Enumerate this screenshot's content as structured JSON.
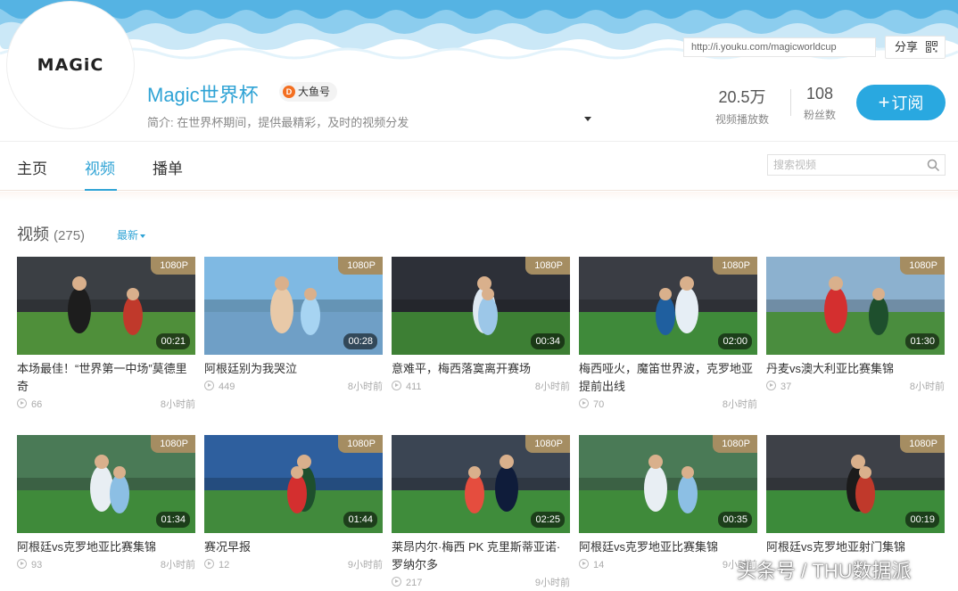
{
  "header": {
    "avatar_logo": "MAGiC",
    "url": "http://i.youku.com/magicworldcup",
    "share_label": "分享",
    "channel_name": "Magic世界杯",
    "dayu_badge": "大鱼号",
    "intro": "简介: 在世界杯期间，提供最精彩，及时的视频分发",
    "stats": [
      {
        "value": "20.5万",
        "label": "视频播放数"
      },
      {
        "value": "108",
        "label": "粉丝数"
      }
    ],
    "subscribe_label": "订阅"
  },
  "nav": {
    "tabs": [
      {
        "label": "主页"
      },
      {
        "label": "视频"
      },
      {
        "label": "播单"
      }
    ],
    "search_placeholder": "搜索视频"
  },
  "section": {
    "title": "视频",
    "count": "(275)",
    "sort_label": "最新"
  },
  "videos": [
    {
      "title": "本场最佳！“世界第一中场”莫德里奇",
      "quality": "1080P",
      "duration": "00:21",
      "plays": "66",
      "time": "8小时前"
    },
    {
      "title": "阿根廷别为我哭泣",
      "quality": "1080P",
      "duration": "00:28",
      "plays": "449",
      "time": "8小时前"
    },
    {
      "title": "意难平，梅西落寞离开赛场",
      "quality": "1080P",
      "duration": "00:34",
      "plays": "411",
      "time": "8小时前"
    },
    {
      "title": "梅西哑火，魔笛世界波，克罗地亚提前出线",
      "quality": "1080P",
      "duration": "02:00",
      "plays": "70",
      "time": "8小时前"
    },
    {
      "title": "丹麦vs澳大利亚比赛集锦",
      "quality": "1080P",
      "duration": "01:30",
      "plays": "37",
      "time": "8小时前"
    },
    {
      "title": "阿根廷vs克罗地亚比赛集锦",
      "quality": "1080P",
      "duration": "01:34",
      "plays": "93",
      "time": "8小时前"
    },
    {
      "title": "赛况早报",
      "quality": "1080P",
      "duration": "01:44",
      "plays": "12",
      "time": "9小时前"
    },
    {
      "title": "莱昂内尔·梅西 PK 克里斯蒂亚诺·罗纳尔多",
      "quality": "1080P",
      "duration": "02:25",
      "plays": "217",
      "time": "9小时前"
    },
    {
      "title": "阿根廷vs克罗地亚比赛集锦",
      "quality": "1080P",
      "duration": "00:35",
      "plays": "14",
      "time": "9小时前"
    },
    {
      "title": "阿根廷vs克罗地亚射门集锦",
      "quality": "1080P",
      "duration": "00:19",
      "plays": "",
      "time": ""
    }
  ],
  "watermark": "头条号 / THU数据派",
  "colors": {
    "accent": "#2fa3d5",
    "subscribe": "#29a8e0",
    "badge": "#a58d62"
  }
}
